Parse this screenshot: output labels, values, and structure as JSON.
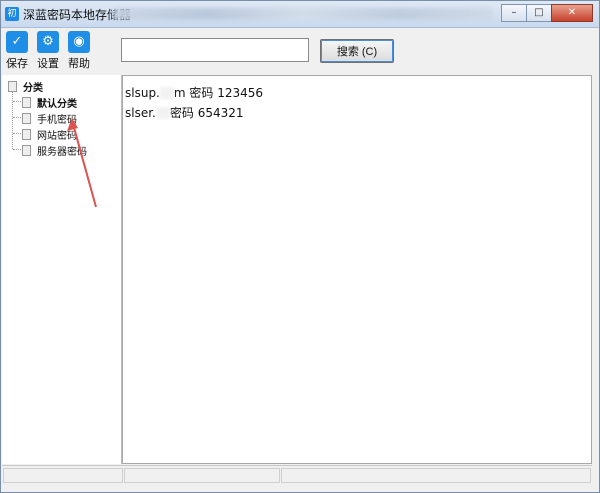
{
  "window": {
    "title": "深蓝密码本地存储器",
    "controls": {
      "minimize": "–",
      "maximize": "□",
      "close": "✕"
    }
  },
  "toolbar": {
    "items": [
      {
        "label": "保存",
        "icon": "check-icon",
        "glyph": "✓"
      },
      {
        "label": "设置",
        "icon": "gear-icon",
        "glyph": "⚙"
      },
      {
        "label": "帮助",
        "icon": "help-icon",
        "glyph": "◉"
      }
    ]
  },
  "search": {
    "value": "",
    "button_label": "搜索 (C)"
  },
  "tree": {
    "root": "分类",
    "items": [
      {
        "label": "默认分类",
        "bold": true
      },
      {
        "label": "手机密码",
        "bold": false
      },
      {
        "label": "网站密码",
        "bold": false
      },
      {
        "label": "服务器密码",
        "bold": false
      }
    ]
  },
  "entries": [
    {
      "prefix": "slsup.",
      "suffix": "m 密码 123456"
    },
    {
      "prefix": "slser.",
      "suffix": "密码 654321"
    }
  ],
  "colors": {
    "accent": "#1e8ee6",
    "annotation_arrow": "#d9534f"
  }
}
